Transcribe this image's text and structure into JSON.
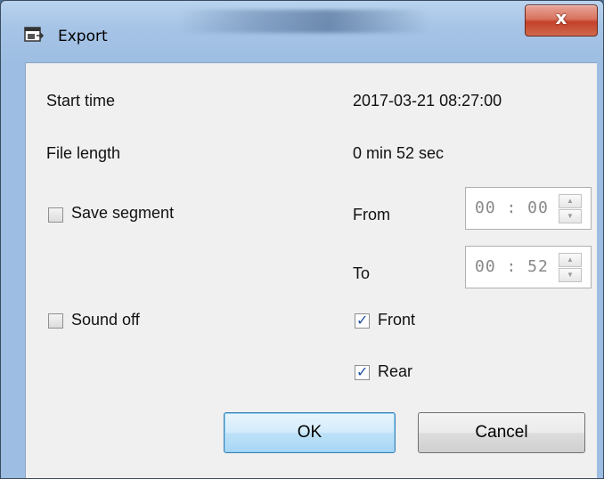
{
  "window": {
    "title": "Export",
    "close_glyph": "x"
  },
  "fields": {
    "start_time_label": "Start time",
    "start_time_value": "2017-03-21 08:27:00",
    "file_length_label": "File length",
    "file_length_value": "0 min 52 sec"
  },
  "segment": {
    "save_label": "Save segment",
    "save_checked": false,
    "from_label": "From",
    "from_value": "00 : 00",
    "to_label": "To",
    "to_value": "00 : 52"
  },
  "audio": {
    "sound_off_label": "Sound off",
    "sound_off_checked": false
  },
  "cameras": {
    "front_label": "Front",
    "front_checked": true,
    "rear_label": "Rear",
    "rear_checked": true
  },
  "buttons": {
    "ok_label": "OK",
    "cancel_label": "Cancel"
  },
  "icons": {
    "app": "export-window-icon",
    "close": "close-icon",
    "spin_up": "chevron-up-icon",
    "spin_down": "chevron-down-icon"
  },
  "colors": {
    "titlebar": "#a6c4e6",
    "close_button": "#c4402a",
    "dialog_background": "#f0f0f0",
    "ok_button": "#bde2f8",
    "checkmark": "#1c4fa3"
  }
}
